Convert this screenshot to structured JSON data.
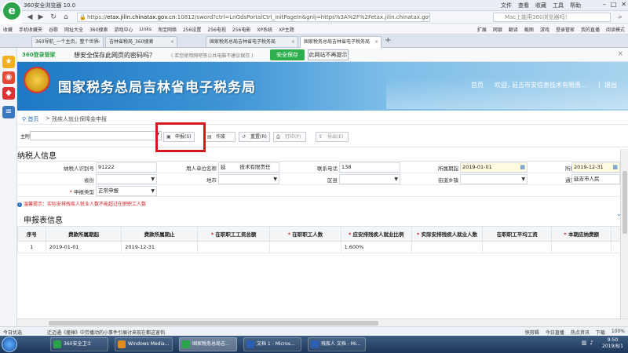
{
  "browser": {
    "title": "360安全浏览器 10.0",
    "menus": [
      "文件",
      "查看",
      "收藏",
      "工具",
      "帮助"
    ],
    "url_prefix": "https://",
    "url_host": "etax.jilin.chinatax.gov.cn",
    "url_rest": ":10812/sword?ctrl=LnGdsPortalCtrl_initPageIn&gnlj=https%3A%2F%2Fetax.jilin.chinatax.gov.cn%3A10812%2Fswo",
    "search_placeholder": "Mac上能用360浏览器吗！",
    "bookmarks": [
      "收藏",
      "手机收藏夹",
      "谷歌",
      "网址大全",
      "360搜索",
      "游戏中心",
      "Links",
      "淘宝网络",
      "256设置",
      "256电视",
      "256电影",
      "XP系统",
      "XP主题"
    ],
    "bookmarks_right": [
      "扩展",
      "网银",
      "翻译",
      "截图",
      "游戏",
      "登录管家",
      "我的直播",
      "阅读模式"
    ],
    "tabs": [
      "360导航_一个主页，整个世界",
      "吉林省税局_360搜索",
      "国家税务总局吉林省电子税务局",
      "国家税务总局吉林省电子税务局"
    ]
  },
  "notice": {
    "brand": "360登录管家",
    "question": "想安全保存此网页的密码吗？",
    "hint": "( 若您使用网吧等公共电脑不建议保存 )",
    "save_label": "安全保存",
    "never_label": "此网站不再提示"
  },
  "banner": {
    "site_name": "国家税务总局吉林省电子税务局",
    "home": "首页",
    "welcome": "欢迎，",
    "company": "延吉市安信息技术有限责...",
    "logout": "退出"
  },
  "breadcrumb": {
    "home": "首页",
    "sep": ">",
    "current": "残疾人就业保障金申报"
  },
  "toolbar": {
    "main_tax_label": "主附表税:",
    "declare": "申报(S)",
    "void": "作废",
    "reset": "重置(R)",
    "print": "打印(P)",
    "export": "导出(E)"
  },
  "taxpayer": {
    "section_title": "纳税人信息",
    "id_label": "纳税人识别号",
    "id_value": "91222",
    "employer_label": "用人单位名称",
    "employer_value": "延",
    "employer_suffix": "技术有限责任",
    "phone_label": "联系电话",
    "phone_value": "138",
    "period_start_label": "所属期起",
    "period_start_value": "2019-01-01",
    "period_end_label": "所属期止",
    "period_end_value": "2019-12-31",
    "province_label": "省份",
    "city_label": "地市",
    "district_label": "区县",
    "street_label": "街道乡镇",
    "address_label": "通讯地址",
    "address_value": "延吉市人民",
    "type_label": "申报类型",
    "type_value": "正常申报"
  },
  "tip": "温馨提示：实际安排残疾人就业人数不能超过在职职工人数",
  "declare_info": {
    "section_title": "申报表信息",
    "columns": [
      "序号",
      "费款所属期起",
      "费款所属期止",
      "在职职工工资总额",
      "在职职工人数",
      "应安排残疾人就业比例",
      "实际安排残疾人就业人数",
      "在职职工平均工资",
      "本期应纳费额"
    ],
    "rows": [
      [
        "1",
        "2019-01-01",
        "2019-12-31",
        "",
        "",
        "1.600%",
        "",
        "",
        ""
      ]
    ]
  },
  "statusbar": {
    "left": "今日优选",
    "news": "迁迈通《撞禅》中劳播动的小事件引展讨来现在都这害怕",
    "right": [
      "快剪辑",
      "今日直播",
      "热点资讯",
      "下载",
      "100%"
    ]
  },
  "taskbar": {
    "items": [
      "360安全卫士",
      "Windows Media...",
      "国家税务总局吉...",
      "文档 1 - Micros...",
      "残疾人 文档 - Mi..."
    ],
    "time": "9:50",
    "date": "2019/8/1"
  },
  "colors": {
    "accent_red": "#d4191e",
    "brand_green": "#2eaf4e",
    "banner_blue": "#1d78c4"
  }
}
